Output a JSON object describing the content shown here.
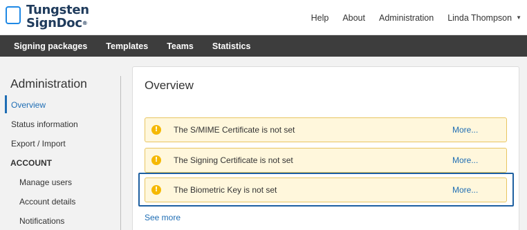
{
  "brand": {
    "line1": "Tungsten",
    "line2": "SignDoc",
    "reg": "®"
  },
  "top_links": {
    "help": "Help",
    "about": "About",
    "administration": "Administration",
    "user": "Linda Thompson",
    "caret": "▼"
  },
  "nav": [
    "Signing packages",
    "Templates",
    "Teams",
    "Statistics"
  ],
  "sidebar": {
    "title": "Administration",
    "items": [
      "Overview",
      "Status information",
      "Export / Import"
    ],
    "active_item": "Overview",
    "section_heading": "ACCOUNT",
    "sub_items": [
      "Manage users",
      "Account details",
      "Notifications"
    ]
  },
  "main": {
    "title": "Overview",
    "alerts": [
      {
        "text": "The S/MIME Certificate is not set",
        "more": "More..."
      },
      {
        "text": "The Signing Certificate is not set",
        "more": "More..."
      },
      {
        "text": "The Biometric Key is not set",
        "more": "More..."
      }
    ],
    "alert_icon": "!",
    "see_more": "See more"
  },
  "colors": {
    "accent": "#1e6db4",
    "nav_bg": "#3d3d3d",
    "alert_bg": "#fff7dc",
    "alert_border": "#e8c560",
    "warning_icon": "#f5b800",
    "highlight": "#1d5fa0"
  }
}
